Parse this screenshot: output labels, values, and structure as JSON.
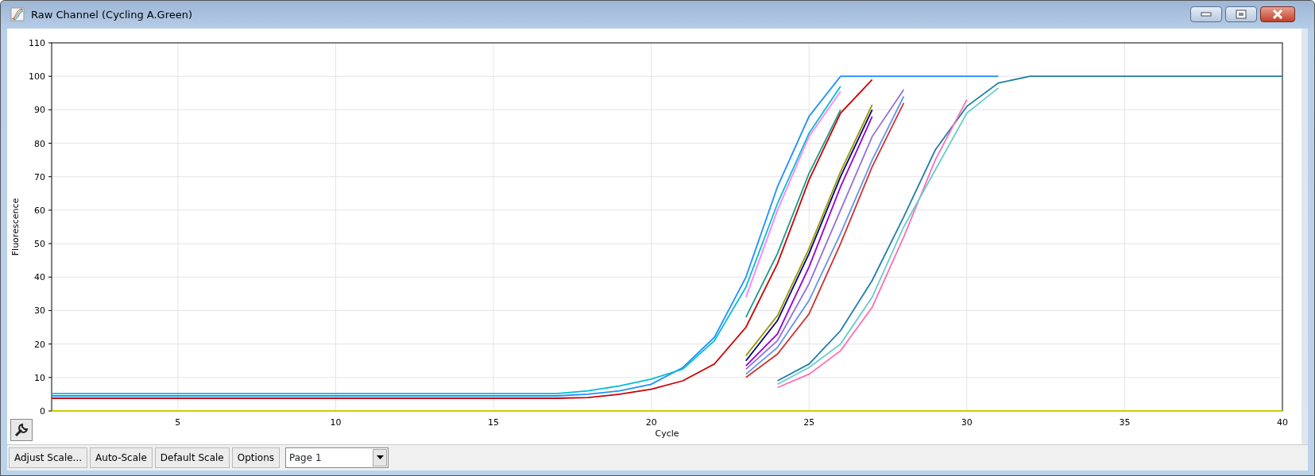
{
  "window": {
    "title": "Raw Channel (Cycling A.Green)"
  },
  "chart": {
    "chart_data": {
      "type": "line",
      "grid": true,
      "xlabel": "Cycle",
      "ylabel": "Fluorescence",
      "xlim": [
        1,
        40
      ],
      "ylim": [
        0,
        110
      ],
      "xticks": [
        5,
        10,
        15,
        20,
        25,
        30,
        35,
        40
      ],
      "yticks": [
        0,
        10,
        20,
        30,
        40,
        50,
        60,
        70,
        80,
        90,
        100,
        110
      ],
      "x": [
        1,
        2,
        3,
        4,
        5,
        6,
        7,
        8,
        9,
        10,
        11,
        12,
        13,
        14,
        15,
        16,
        17,
        18,
        19,
        20,
        21,
        22,
        23,
        24,
        25,
        26,
        27,
        28,
        29,
        30,
        31,
        32,
        33,
        34,
        35,
        36,
        37,
        38,
        39,
        40
      ],
      "series": [
        {
          "color": "#1e90ff",
          "values": [
            4.5,
            4.5,
            4.5,
            4.5,
            4.5,
            4.5,
            4.5,
            4.5,
            4.5,
            4.5,
            4.5,
            4.5,
            4.5,
            4.5,
            4.5,
            4.5,
            4.5,
            5,
            6,
            8,
            13,
            22,
            40,
            67,
            88,
            100,
            100,
            100,
            100,
            100,
            100,
            null,
            null,
            null,
            null,
            null,
            null,
            null,
            null,
            null
          ]
        },
        {
          "color": "#00bcd4",
          "values": [
            5.2,
            5.2,
            5.2,
            5.2,
            5.2,
            5.2,
            5.2,
            5.2,
            5.2,
            5.2,
            5.2,
            5.2,
            5.2,
            5.2,
            5.2,
            5.2,
            5.2,
            6,
            7.5,
            9.5,
            12.5,
            21,
            37,
            62,
            83,
            97,
            null,
            null,
            null,
            null,
            null,
            null,
            null,
            null,
            null,
            null,
            null,
            null,
            null,
            null
          ]
        },
        {
          "color": "#ff80ff",
          "values": [
            null,
            null,
            null,
            null,
            null,
            null,
            null,
            null,
            null,
            null,
            null,
            null,
            null,
            null,
            null,
            null,
            null,
            null,
            null,
            null,
            null,
            null,
            34,
            60,
            82,
            95.5,
            null,
            null,
            null,
            null,
            null,
            null,
            null,
            null,
            null,
            null,
            null,
            null,
            null,
            null
          ]
        },
        {
          "color": "#1a9a8a",
          "values": [
            null,
            null,
            null,
            null,
            null,
            null,
            null,
            null,
            null,
            null,
            null,
            null,
            null,
            null,
            null,
            null,
            null,
            null,
            null,
            null,
            null,
            null,
            28,
            47,
            71,
            90,
            null,
            null,
            null,
            null,
            null,
            null,
            null,
            null,
            null,
            null,
            null,
            null,
            null,
            null
          ]
        },
        {
          "color": "#cc0000",
          "values": [
            3.8,
            3.8,
            3.8,
            3.8,
            3.8,
            3.8,
            3.8,
            3.8,
            3.8,
            3.8,
            3.8,
            3.8,
            3.8,
            3.8,
            3.8,
            3.8,
            3.8,
            4,
            5,
            6.5,
            9,
            14,
            25,
            44,
            69,
            89,
            99,
            null,
            null,
            null,
            null,
            null,
            null,
            null,
            null,
            null,
            null,
            null,
            null,
            null
          ]
        },
        {
          "color": "#000080",
          "values": [
            null,
            null,
            null,
            null,
            null,
            null,
            null,
            null,
            null,
            null,
            null,
            null,
            null,
            null,
            null,
            null,
            null,
            null,
            null,
            null,
            null,
            null,
            15,
            27,
            47,
            70,
            90,
            null,
            null,
            null,
            null,
            null,
            null,
            null,
            null,
            null,
            null,
            null,
            null,
            null
          ]
        },
        {
          "color": "#999900",
          "values": [
            null,
            null,
            null,
            null,
            null,
            null,
            null,
            null,
            null,
            null,
            null,
            null,
            null,
            null,
            null,
            null,
            null,
            null,
            null,
            null,
            null,
            null,
            16.5,
            28.5,
            48.5,
            71.5,
            91.5,
            null,
            null,
            null,
            null,
            null,
            null,
            null,
            null,
            null,
            null,
            null,
            null,
            null
          ]
        },
        {
          "color": "#9900cc",
          "values": [
            null,
            null,
            null,
            null,
            null,
            null,
            null,
            null,
            null,
            null,
            null,
            null,
            null,
            null,
            null,
            null,
            null,
            null,
            null,
            null,
            null,
            null,
            13.5,
            23,
            43,
            67,
            88,
            null,
            null,
            null,
            null,
            null,
            null,
            null,
            null,
            null,
            null,
            null,
            null,
            null
          ]
        },
        {
          "color": "#cc3333",
          "values": [
            null,
            null,
            null,
            null,
            null,
            null,
            null,
            null,
            null,
            null,
            null,
            null,
            null,
            null,
            null,
            null,
            null,
            null,
            null,
            null,
            null,
            null,
            10,
            17,
            29,
            50,
            73,
            92,
            null,
            null,
            null,
            null,
            null,
            null,
            null,
            null,
            null,
            null,
            null,
            null
          ]
        },
        {
          "color": "#9370db",
          "values": [
            null,
            null,
            null,
            null,
            null,
            null,
            null,
            null,
            null,
            null,
            null,
            null,
            null,
            null,
            null,
            null,
            null,
            null,
            null,
            null,
            null,
            null,
            12.5,
            21,
            38,
            60,
            82,
            96,
            null,
            null,
            null,
            null,
            null,
            null,
            null,
            null,
            null,
            null,
            null,
            null
          ]
        },
        {
          "color": "#6495ed",
          "values": [
            null,
            null,
            null,
            null,
            null,
            null,
            null,
            null,
            null,
            null,
            null,
            null,
            null,
            null,
            null,
            null,
            null,
            null,
            null,
            null,
            null,
            null,
            11,
            19,
            33,
            53,
            75,
            94,
            null,
            null,
            null,
            null,
            null,
            null,
            null,
            null,
            null,
            null,
            null,
            null
          ]
        },
        {
          "color": "#1f7fa8",
          "values": [
            null,
            null,
            null,
            null,
            null,
            null,
            null,
            null,
            null,
            null,
            null,
            null,
            null,
            null,
            null,
            null,
            null,
            null,
            null,
            null,
            null,
            null,
            null,
            9,
            14,
            24,
            39,
            58,
            78,
            91,
            98,
            100,
            100,
            100,
            100,
            100,
            100,
            100,
            100,
            100
          ]
        },
        {
          "color": "#ff6eb4",
          "values": [
            null,
            null,
            null,
            null,
            null,
            null,
            null,
            null,
            null,
            null,
            null,
            null,
            null,
            null,
            null,
            null,
            null,
            null,
            null,
            null,
            null,
            null,
            null,
            7,
            11,
            18,
            31,
            52,
            75,
            93,
            null,
            null,
            null,
            null,
            null,
            null,
            null,
            null,
            null,
            null
          ]
        },
        {
          "color": "#66cccc",
          "values": [
            null,
            null,
            null,
            null,
            null,
            null,
            null,
            null,
            null,
            null,
            null,
            null,
            null,
            null,
            null,
            null,
            null,
            null,
            null,
            null,
            null,
            null,
            null,
            8,
            13,
            20,
            34,
            55,
            72,
            89,
            96.5,
            null,
            null,
            null,
            null,
            null,
            null,
            null,
            null,
            null
          ]
        },
        {
          "color": "#cccc00",
          "values": [
            0,
            0,
            0,
            0,
            0,
            0,
            0,
            0,
            0,
            0,
            0,
            0,
            0,
            0,
            0,
            0,
            0,
            0,
            0,
            0,
            0,
            0,
            0,
            0,
            0,
            0,
            0,
            0,
            0,
            0,
            0,
            0,
            0,
            0,
            0,
            0,
            0,
            0,
            0,
            0
          ]
        }
      ]
    }
  },
  "toolbar": {
    "buttons": [
      "Adjust Scale...",
      "Auto-Scale",
      "Default Scale",
      "Options"
    ],
    "page_select": {
      "value": "Page 1"
    }
  }
}
